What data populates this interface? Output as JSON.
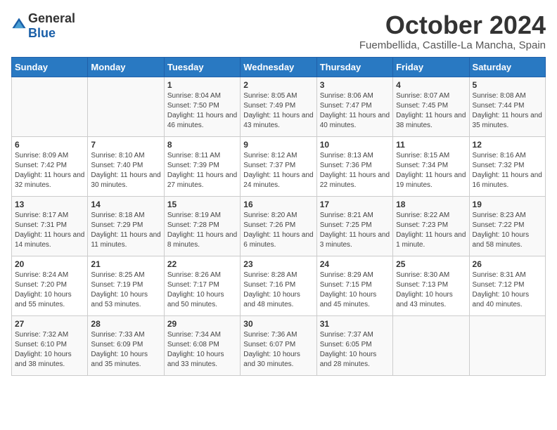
{
  "header": {
    "logo": {
      "general": "General",
      "blue": "Blue"
    },
    "title": "October 2024",
    "location": "Fuembellida, Castille-La Mancha, Spain"
  },
  "days_of_week": [
    "Sunday",
    "Monday",
    "Tuesday",
    "Wednesday",
    "Thursday",
    "Friday",
    "Saturday"
  ],
  "weeks": [
    [
      {
        "day": "",
        "sunrise": "",
        "sunset": "",
        "daylight": ""
      },
      {
        "day": "",
        "sunrise": "",
        "sunset": "",
        "daylight": ""
      },
      {
        "day": "1",
        "sunrise": "Sunrise: 8:04 AM",
        "sunset": "Sunset: 7:50 PM",
        "daylight": "Daylight: 11 hours and 46 minutes."
      },
      {
        "day": "2",
        "sunrise": "Sunrise: 8:05 AM",
        "sunset": "Sunset: 7:49 PM",
        "daylight": "Daylight: 11 hours and 43 minutes."
      },
      {
        "day": "3",
        "sunrise": "Sunrise: 8:06 AM",
        "sunset": "Sunset: 7:47 PM",
        "daylight": "Daylight: 11 hours and 40 minutes."
      },
      {
        "day": "4",
        "sunrise": "Sunrise: 8:07 AM",
        "sunset": "Sunset: 7:45 PM",
        "daylight": "Daylight: 11 hours and 38 minutes."
      },
      {
        "day": "5",
        "sunrise": "Sunrise: 8:08 AM",
        "sunset": "Sunset: 7:44 PM",
        "daylight": "Daylight: 11 hours and 35 minutes."
      }
    ],
    [
      {
        "day": "6",
        "sunrise": "Sunrise: 8:09 AM",
        "sunset": "Sunset: 7:42 PM",
        "daylight": "Daylight: 11 hours and 32 minutes."
      },
      {
        "day": "7",
        "sunrise": "Sunrise: 8:10 AM",
        "sunset": "Sunset: 7:40 PM",
        "daylight": "Daylight: 11 hours and 30 minutes."
      },
      {
        "day": "8",
        "sunrise": "Sunrise: 8:11 AM",
        "sunset": "Sunset: 7:39 PM",
        "daylight": "Daylight: 11 hours and 27 minutes."
      },
      {
        "day": "9",
        "sunrise": "Sunrise: 8:12 AM",
        "sunset": "Sunset: 7:37 PM",
        "daylight": "Daylight: 11 hours and 24 minutes."
      },
      {
        "day": "10",
        "sunrise": "Sunrise: 8:13 AM",
        "sunset": "Sunset: 7:36 PM",
        "daylight": "Daylight: 11 hours and 22 minutes."
      },
      {
        "day": "11",
        "sunrise": "Sunrise: 8:15 AM",
        "sunset": "Sunset: 7:34 PM",
        "daylight": "Daylight: 11 hours and 19 minutes."
      },
      {
        "day": "12",
        "sunrise": "Sunrise: 8:16 AM",
        "sunset": "Sunset: 7:32 PM",
        "daylight": "Daylight: 11 hours and 16 minutes."
      }
    ],
    [
      {
        "day": "13",
        "sunrise": "Sunrise: 8:17 AM",
        "sunset": "Sunset: 7:31 PM",
        "daylight": "Daylight: 11 hours and 14 minutes."
      },
      {
        "day": "14",
        "sunrise": "Sunrise: 8:18 AM",
        "sunset": "Sunset: 7:29 PM",
        "daylight": "Daylight: 11 hours and 11 minutes."
      },
      {
        "day": "15",
        "sunrise": "Sunrise: 8:19 AM",
        "sunset": "Sunset: 7:28 PM",
        "daylight": "Daylight: 11 hours and 8 minutes."
      },
      {
        "day": "16",
        "sunrise": "Sunrise: 8:20 AM",
        "sunset": "Sunset: 7:26 PM",
        "daylight": "Daylight: 11 hours and 6 minutes."
      },
      {
        "day": "17",
        "sunrise": "Sunrise: 8:21 AM",
        "sunset": "Sunset: 7:25 PM",
        "daylight": "Daylight: 11 hours and 3 minutes."
      },
      {
        "day": "18",
        "sunrise": "Sunrise: 8:22 AM",
        "sunset": "Sunset: 7:23 PM",
        "daylight": "Daylight: 11 hours and 1 minute."
      },
      {
        "day": "19",
        "sunrise": "Sunrise: 8:23 AM",
        "sunset": "Sunset: 7:22 PM",
        "daylight": "Daylight: 10 hours and 58 minutes."
      }
    ],
    [
      {
        "day": "20",
        "sunrise": "Sunrise: 8:24 AM",
        "sunset": "Sunset: 7:20 PM",
        "daylight": "Daylight: 10 hours and 55 minutes."
      },
      {
        "day": "21",
        "sunrise": "Sunrise: 8:25 AM",
        "sunset": "Sunset: 7:19 PM",
        "daylight": "Daylight: 10 hours and 53 minutes."
      },
      {
        "day": "22",
        "sunrise": "Sunrise: 8:26 AM",
        "sunset": "Sunset: 7:17 PM",
        "daylight": "Daylight: 10 hours and 50 minutes."
      },
      {
        "day": "23",
        "sunrise": "Sunrise: 8:28 AM",
        "sunset": "Sunset: 7:16 PM",
        "daylight": "Daylight: 10 hours and 48 minutes."
      },
      {
        "day": "24",
        "sunrise": "Sunrise: 8:29 AM",
        "sunset": "Sunset: 7:15 PM",
        "daylight": "Daylight: 10 hours and 45 minutes."
      },
      {
        "day": "25",
        "sunrise": "Sunrise: 8:30 AM",
        "sunset": "Sunset: 7:13 PM",
        "daylight": "Daylight: 10 hours and 43 minutes."
      },
      {
        "day": "26",
        "sunrise": "Sunrise: 8:31 AM",
        "sunset": "Sunset: 7:12 PM",
        "daylight": "Daylight: 10 hours and 40 minutes."
      }
    ],
    [
      {
        "day": "27",
        "sunrise": "Sunrise: 7:32 AM",
        "sunset": "Sunset: 6:10 PM",
        "daylight": "Daylight: 10 hours and 38 minutes."
      },
      {
        "day": "28",
        "sunrise": "Sunrise: 7:33 AM",
        "sunset": "Sunset: 6:09 PM",
        "daylight": "Daylight: 10 hours and 35 minutes."
      },
      {
        "day": "29",
        "sunrise": "Sunrise: 7:34 AM",
        "sunset": "Sunset: 6:08 PM",
        "daylight": "Daylight: 10 hours and 33 minutes."
      },
      {
        "day": "30",
        "sunrise": "Sunrise: 7:36 AM",
        "sunset": "Sunset: 6:07 PM",
        "daylight": "Daylight: 10 hours and 30 minutes."
      },
      {
        "day": "31",
        "sunrise": "Sunrise: 7:37 AM",
        "sunset": "Sunset: 6:05 PM",
        "daylight": "Daylight: 10 hours and 28 minutes."
      },
      {
        "day": "",
        "sunrise": "",
        "sunset": "",
        "daylight": ""
      },
      {
        "day": "",
        "sunrise": "",
        "sunset": "",
        "daylight": ""
      }
    ]
  ]
}
